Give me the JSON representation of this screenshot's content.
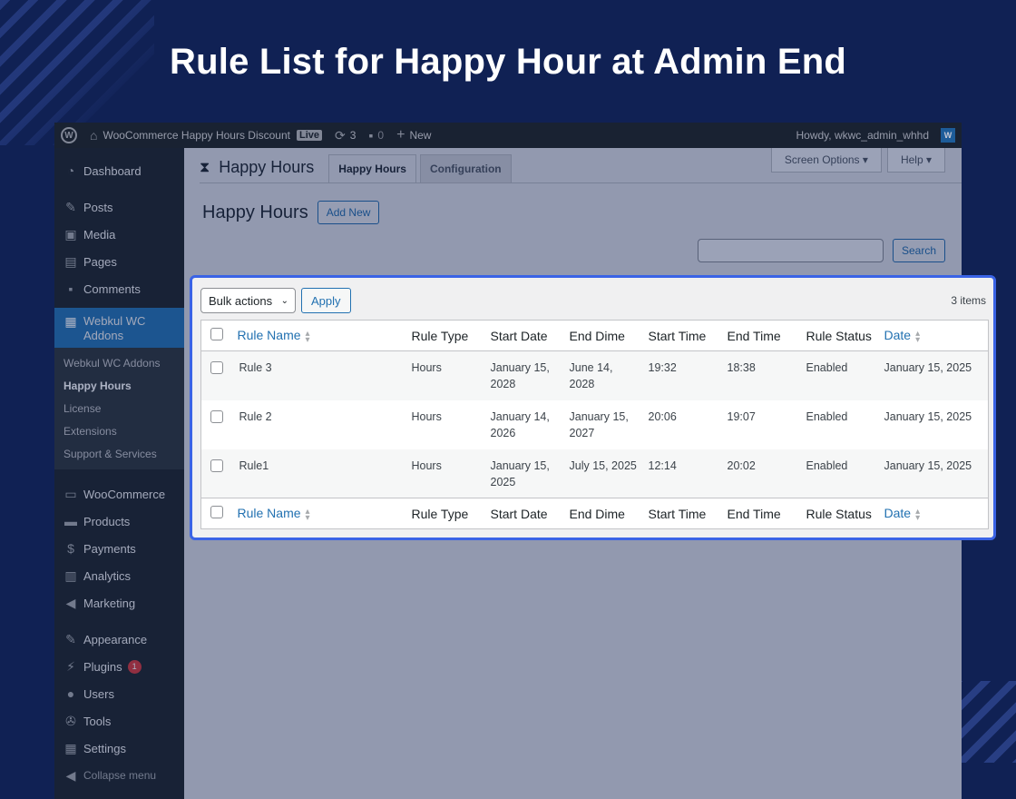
{
  "headline": "Rule List for Happy Hour at Admin End",
  "adminbar": {
    "site_name": "WooCommerce Happy Hours Discount",
    "live_badge": "Live",
    "updates_count": "3",
    "comments_count": "0",
    "new_label": "New",
    "howdy": "Howdy, wkwc_admin_whhd"
  },
  "sidebar": {
    "items_top": [
      {
        "label": "Dashboard",
        "icon": "dashboard-icon"
      },
      {
        "label": "Posts",
        "icon": "pin-icon"
      },
      {
        "label": "Media",
        "icon": "media-icon"
      },
      {
        "label": "Pages",
        "icon": "pages-icon"
      },
      {
        "label": "Comments",
        "icon": "comment-icon"
      }
    ],
    "active_item": "Webkul WC Addons",
    "submenu": [
      "Webkul WC Addons",
      "Happy Hours",
      "License",
      "Extensions",
      "Support & Services"
    ],
    "items_bottom": [
      {
        "label": "WooCommerce"
      },
      {
        "label": "Products"
      },
      {
        "label": "Payments"
      },
      {
        "label": "Analytics"
      },
      {
        "label": "Marketing"
      },
      {
        "label": "Appearance"
      },
      {
        "label": "Plugins",
        "badge": "1"
      },
      {
        "label": "Users"
      },
      {
        "label": "Tools"
      },
      {
        "label": "Settings"
      }
    ],
    "collapse": "Collapse menu"
  },
  "plugin": {
    "title": "Happy Hours",
    "tabs": [
      "Happy Hours",
      "Configuration"
    ],
    "screen_options": "Screen Options",
    "help": "Help"
  },
  "page": {
    "heading": "Happy Hours",
    "add_new": "Add New",
    "search_button": "Search"
  },
  "list": {
    "bulk_actions": "Bulk actions",
    "apply": "Apply",
    "items_count": "3 items",
    "columns": [
      "Rule Name",
      "Rule Type",
      "Start Date",
      "End Dime",
      "Start Time",
      "End Time",
      "Rule Status",
      "Date"
    ],
    "rows": [
      {
        "name": "Rule 3",
        "type": "Hours",
        "start_date": "January 15, 2028",
        "end_date": "June 14, 2028",
        "start_time": "19:32",
        "end_time": "18:38",
        "status": "Enabled",
        "date": "January 15, 2025"
      },
      {
        "name": "Rule 2",
        "type": "Hours",
        "start_date": "January 14, 2026",
        "end_date": "January 15, 2027",
        "start_time": "20:06",
        "end_time": "19:07",
        "status": "Enabled",
        "date": "January 15, 2025"
      },
      {
        "name": "Rule1",
        "type": "Hours",
        "start_date": "January 15, 2025",
        "end_date": "July 15, 2025",
        "start_time": "12:14",
        "end_time": "20:02",
        "status": "Enabled",
        "date": "January 15, 2025"
      }
    ]
  },
  "colors": {
    "background": "#102154",
    "highlight_border": "#3a63e6",
    "wp_blue": "#2271b1",
    "admin_dark": "#1d2327"
  }
}
